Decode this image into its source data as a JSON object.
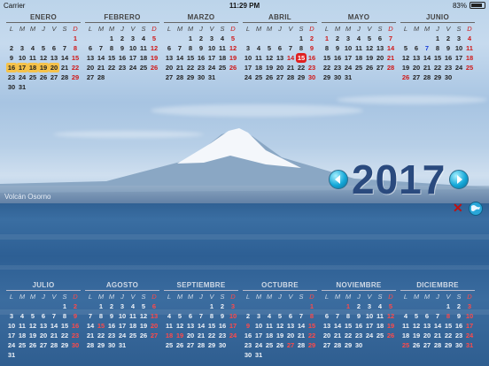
{
  "status_bar": {
    "carrier": "Carrier",
    "time": "11:29 PM",
    "battery": "83%"
  },
  "weekday_headers": [
    "L",
    "M",
    "M",
    "J",
    "V",
    "S",
    "D"
  ],
  "year": "2017",
  "photo_caption": "Volcán Osorno",
  "icons": {
    "prev": "left-arrow-icon",
    "next": "right-arrow-icon",
    "close": "close-icon",
    "globe": "globe-icon"
  },
  "colors": {
    "sunday": "#d01818",
    "today": "#e02020",
    "highlight": "#f5c24a",
    "year_text": "#2a4a7e",
    "nav_button": "#14a8d8"
  },
  "months": [
    {
      "name": "ENERO",
      "weeks": [
        [
          "",
          "",
          "",
          "",
          "",
          "",
          "1"
        ],
        [
          "2",
          "3",
          "4",
          "5",
          "6",
          "7",
          "8"
        ],
        [
          "9",
          "10",
          "11",
          "12",
          "13",
          "14",
          "15"
        ],
        [
          "16",
          "17",
          "18",
          "19",
          "20",
          "21",
          "22"
        ],
        [
          "23",
          "24",
          "25",
          "26",
          "27",
          "28",
          "29"
        ],
        [
          "30",
          "31",
          "",
          "",
          "",
          "",
          ""
        ]
      ]
    },
    {
      "name": "FEBRERO",
      "weeks": [
        [
          "",
          "",
          "1",
          "2",
          "3",
          "4",
          "5"
        ],
        [
          "6",
          "7",
          "8",
          "9",
          "10",
          "11",
          "12"
        ],
        [
          "13",
          "14",
          "15",
          "16",
          "17",
          "18",
          "19"
        ],
        [
          "20",
          "21",
          "22",
          "23",
          "24",
          "25",
          "26"
        ],
        [
          "27",
          "28",
          "",
          "",
          "",
          "",
          ""
        ]
      ]
    },
    {
      "name": "MARZO",
      "weeks": [
        [
          "",
          "",
          "1",
          "2",
          "3",
          "4",
          "5"
        ],
        [
          "6",
          "7",
          "8",
          "9",
          "10",
          "11",
          "12"
        ],
        [
          "13",
          "14",
          "15",
          "16",
          "17",
          "18",
          "19"
        ],
        [
          "20",
          "21",
          "22",
          "23",
          "24",
          "25",
          "26"
        ],
        [
          "27",
          "28",
          "29",
          "30",
          "31",
          "",
          ""
        ]
      ]
    },
    {
      "name": "ABRIL",
      "weeks": [
        [
          "",
          "",
          "",
          "",
          "",
          "1",
          "2"
        ],
        [
          "3",
          "4",
          "5",
          "6",
          "7",
          "8",
          "9"
        ],
        [
          "10",
          "11",
          "12",
          "13",
          "14",
          "15",
          "16"
        ],
        [
          "17",
          "18",
          "19",
          "20",
          "21",
          "22",
          "23"
        ],
        [
          "24",
          "25",
          "26",
          "27",
          "28",
          "29",
          "30"
        ]
      ]
    },
    {
      "name": "MAYO",
      "weeks": [
        [
          "1",
          "2",
          "3",
          "4",
          "5",
          "6",
          "7"
        ],
        [
          "8",
          "9",
          "10",
          "11",
          "12",
          "13",
          "14"
        ],
        [
          "15",
          "16",
          "17",
          "18",
          "19",
          "20",
          "21"
        ],
        [
          "22",
          "23",
          "24",
          "25",
          "26",
          "27",
          "28"
        ],
        [
          "29",
          "30",
          "31",
          "",
          "",
          "",
          ""
        ]
      ]
    },
    {
      "name": "JUNIO",
      "weeks": [
        [
          "",
          "",
          "",
          "1",
          "2",
          "3",
          "4"
        ],
        [
          "5",
          "6",
          "7",
          "8",
          "9",
          "10",
          "11"
        ],
        [
          "12",
          "13",
          "14",
          "15",
          "16",
          "17",
          "18"
        ],
        [
          "19",
          "20",
          "21",
          "22",
          "23",
          "24",
          "25"
        ],
        [
          "26",
          "27",
          "28",
          "29",
          "30",
          "",
          ""
        ]
      ]
    },
    {
      "name": "JULIO",
      "weeks": [
        [
          "",
          "",
          "",
          "",
          "",
          "1",
          "2"
        ],
        [
          "3",
          "4",
          "5",
          "6",
          "7",
          "8",
          "9"
        ],
        [
          "10",
          "11",
          "12",
          "13",
          "14",
          "15",
          "16"
        ],
        [
          "17",
          "18",
          "19",
          "20",
          "21",
          "22",
          "23"
        ],
        [
          "24",
          "25",
          "26",
          "27",
          "28",
          "29",
          "30"
        ],
        [
          "31",
          "",
          "",
          "",
          "",
          "",
          ""
        ]
      ]
    },
    {
      "name": "AGOSTO",
      "weeks": [
        [
          "",
          "1",
          "2",
          "3",
          "4",
          "5",
          "6"
        ],
        [
          "7",
          "8",
          "9",
          "10",
          "11",
          "12",
          "13"
        ],
        [
          "14",
          "15",
          "16",
          "17",
          "18",
          "19",
          "20"
        ],
        [
          "21",
          "22",
          "23",
          "24",
          "25",
          "26",
          "27"
        ],
        [
          "28",
          "29",
          "30",
          "31",
          "",
          "",
          ""
        ]
      ]
    },
    {
      "name": "SEPTIEMBRE",
      "weeks": [
        [
          "",
          "",
          "",
          "",
          "1",
          "2",
          "3"
        ],
        [
          "4",
          "5",
          "6",
          "7",
          "8",
          "9",
          "10"
        ],
        [
          "11",
          "12",
          "13",
          "14",
          "15",
          "16",
          "17"
        ],
        [
          "18",
          "19",
          "20",
          "21",
          "22",
          "23",
          "24"
        ],
        [
          "25",
          "26",
          "27",
          "28",
          "29",
          "30",
          ""
        ]
      ]
    },
    {
      "name": "OCTUBRE",
      "weeks": [
        [
          "",
          "",
          "",
          "",
          "",
          "",
          "1"
        ],
        [
          "2",
          "3",
          "4",
          "5",
          "6",
          "7",
          "8"
        ],
        [
          "9",
          "10",
          "11",
          "12",
          "13",
          "14",
          "15"
        ],
        [
          "16",
          "17",
          "18",
          "19",
          "20",
          "21",
          "22"
        ],
        [
          "23",
          "24",
          "25",
          "26",
          "27",
          "28",
          "29"
        ],
        [
          "30",
          "31",
          "",
          "",
          "",
          "",
          ""
        ]
      ]
    },
    {
      "name": "NOVIEMBRE",
      "weeks": [
        [
          "",
          "",
          "1",
          "2",
          "3",
          "4",
          "5"
        ],
        [
          "6",
          "7",
          "8",
          "9",
          "10",
          "11",
          "12"
        ],
        [
          "13",
          "14",
          "15",
          "16",
          "17",
          "18",
          "19"
        ],
        [
          "20",
          "21",
          "22",
          "23",
          "24",
          "25",
          "26"
        ],
        [
          "27",
          "28",
          "29",
          "30",
          "",
          "",
          ""
        ]
      ]
    },
    {
      "name": "DICIEMBRE",
      "weeks": [
        [
          "",
          "",
          "",
          "",
          "1",
          "2",
          "3"
        ],
        [
          "4",
          "5",
          "6",
          "7",
          "8",
          "9",
          "10"
        ],
        [
          "11",
          "12",
          "13",
          "14",
          "15",
          "16",
          "17"
        ],
        [
          "18",
          "19",
          "20",
          "21",
          "22",
          "23",
          "24"
        ],
        [
          "25",
          "26",
          "27",
          "28",
          "29",
          "30",
          "31"
        ]
      ]
    }
  ],
  "highlights": {
    "ENERO": [
      "16",
      "17",
      "18",
      "19",
      "20"
    ]
  },
  "today": {
    "month": "ABRIL",
    "day": "15"
  },
  "holidays": {
    "ABRIL": [
      "14"
    ],
    "MAYO": [
      "1",
      "21"
    ],
    "JUNIO": [
      "7",
      "26"
    ],
    "JULIO": [
      "16"
    ],
    "AGOSTO": [
      "15"
    ],
    "SEPTIEMBRE": [
      "18",
      "19"
    ],
    "OCTUBRE": [
      "9",
      "27"
    ],
    "NOVIEMBRE": [
      "1"
    ],
    "DICIEMBRE": [
      "8",
      "25"
    ]
  }
}
